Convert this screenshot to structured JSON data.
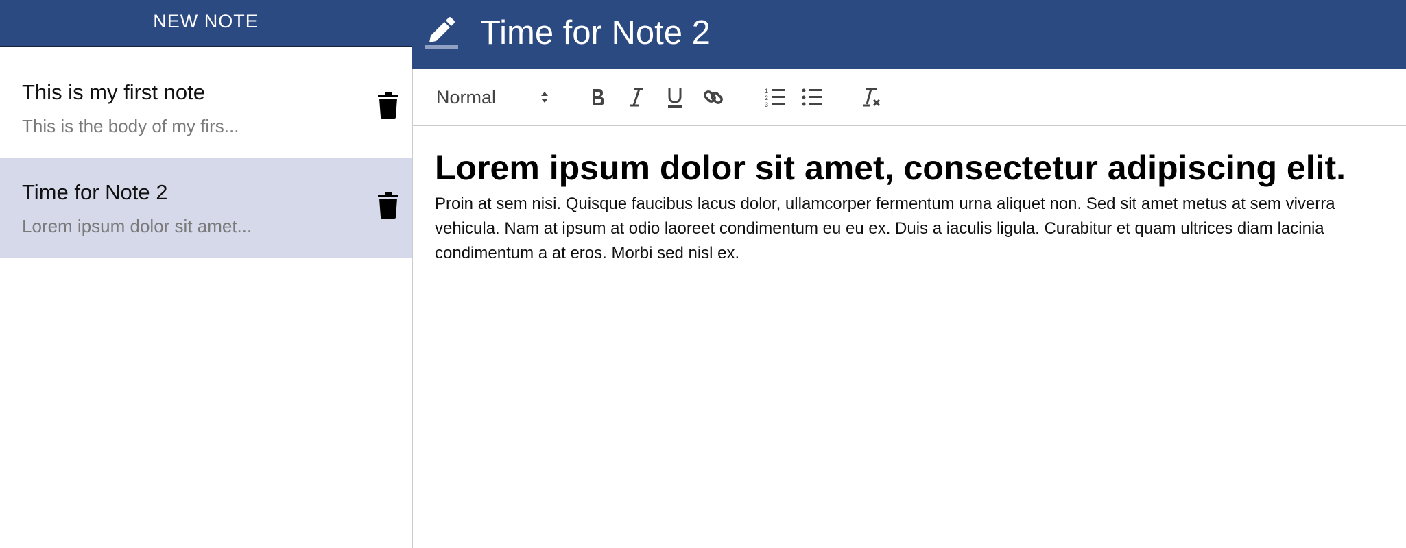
{
  "sidebar": {
    "new_note_label": "NEW NOTE",
    "notes": [
      {
        "title": "This is my first note",
        "preview": "This is the body of my firs...",
        "selected": false
      },
      {
        "title": "Time for Note 2",
        "preview": "Lorem ipsum dolor sit amet...",
        "selected": true
      }
    ]
  },
  "editor": {
    "title": "Time for Note 2",
    "toolbar": {
      "format_value": "Normal",
      "buttons": [
        "bold-icon",
        "italic-icon",
        "underline-icon",
        "link-icon",
        "ordered-list-icon",
        "bullet-list-icon",
        "clear-format-icon"
      ]
    },
    "content": {
      "heading": "Lorem ipsum dolor sit amet, consectetur adipiscing elit.",
      "body": "Proin at sem nisi. Quisque faucibus lacus dolor, ullamcorper fermentum urna aliquet non. Sed sit amet metus at sem viverra vehicula. Nam at ipsum at odio laoreet condimentum eu eu ex. Duis a iaculis ligula. Curabitur et quam ultrices diam lacinia condimentum a at eros. Morbi sed nisl ex."
    }
  },
  "colors": {
    "header_blue": "#2b4a82",
    "selected_note_bg": "#d6d9ea",
    "preview_gray": "#7a7a7a"
  }
}
